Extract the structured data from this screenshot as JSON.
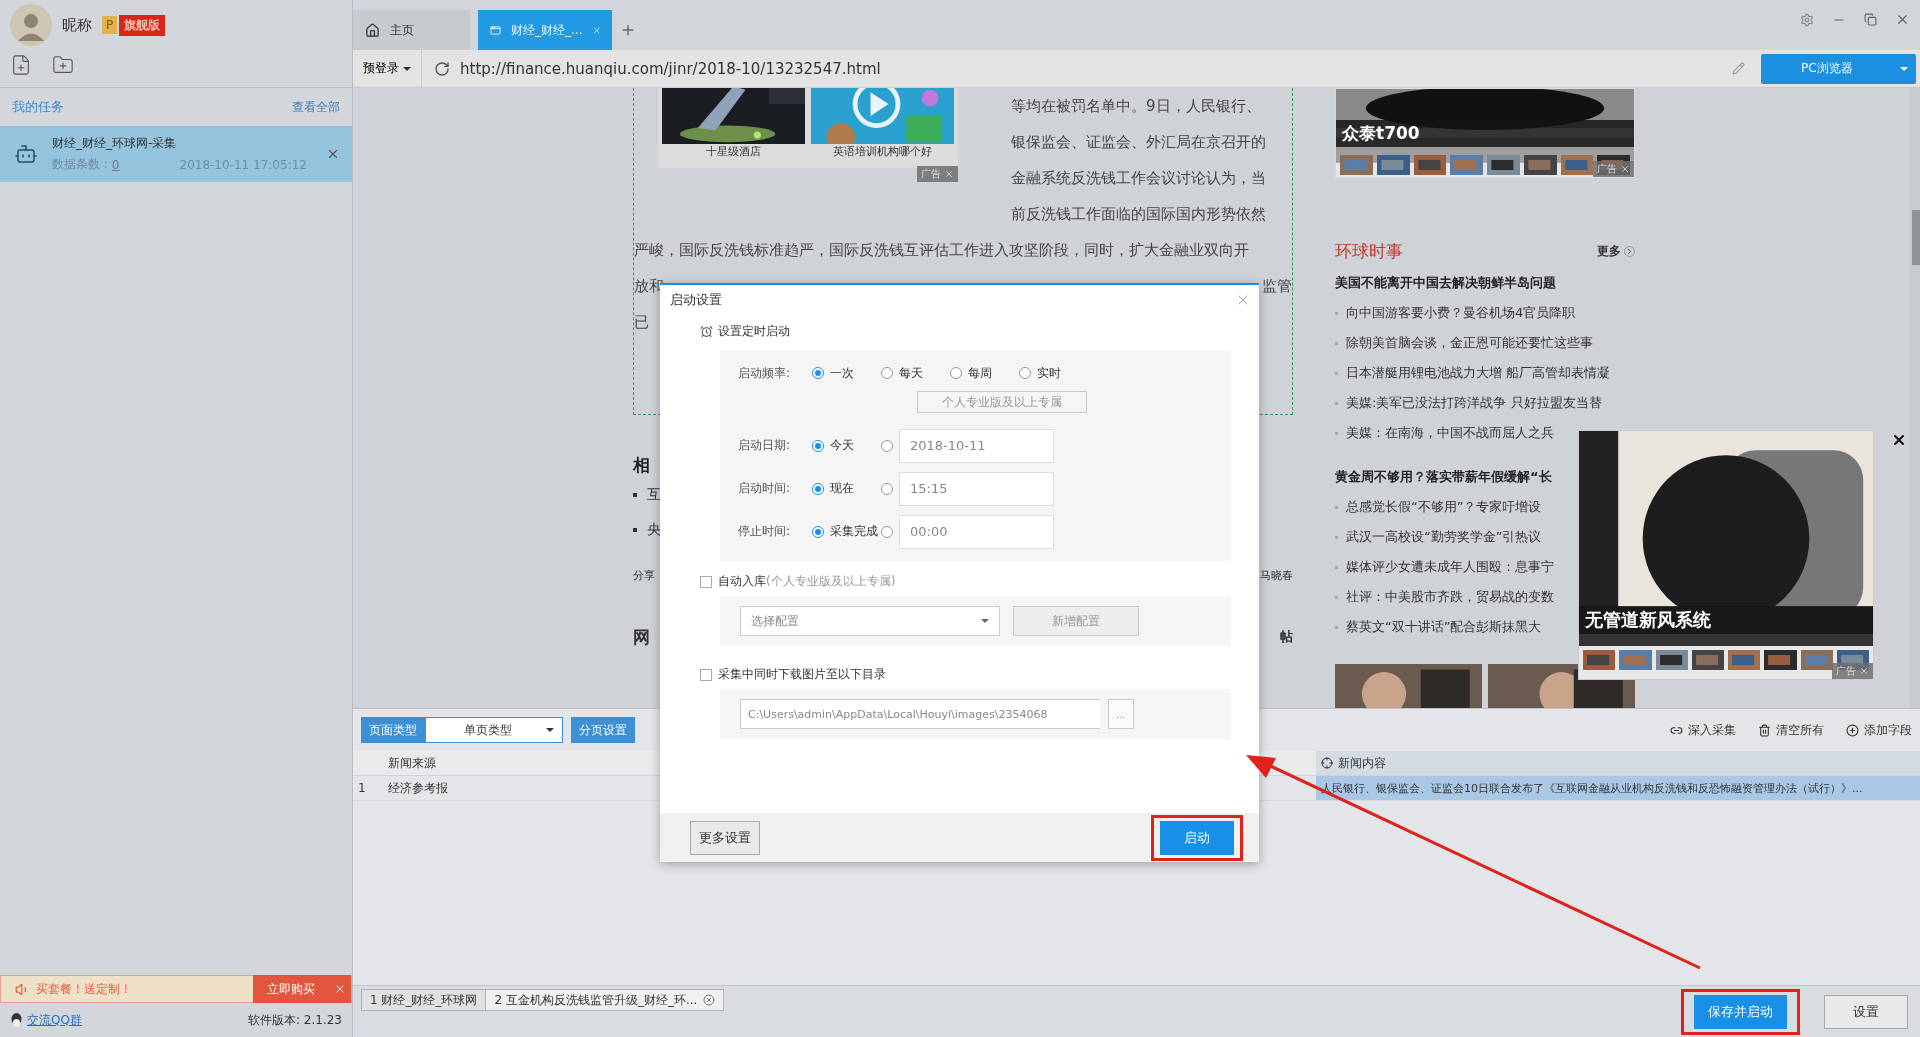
{
  "user": {
    "nickname": "昵称",
    "tier_letter": "P",
    "tier": "旗舰版"
  },
  "sidebar": {
    "section_title": "我的任务",
    "view_all": "查看全部",
    "tasks": [
      {
        "name": "财经_财经_环球网-采集",
        "count_label": "数据条数 :",
        "count": "0",
        "time": "2018-10-11 17:05:12",
        "selected": true
      }
    ],
    "promo": {
      "text": "买套餐！送定制！",
      "action": "立即购买"
    },
    "footer": {
      "qq_group": "交流QQ群",
      "version": "软件版本: 2.1.23"
    }
  },
  "browser": {
    "tabs": [
      {
        "kind": "home",
        "label": "主页",
        "selected": false
      },
      {
        "kind": "page",
        "label": "财经_财经_...",
        "selected": true
      }
    ],
    "prelogin": "预登录",
    "url": "http://finance.huanqiu.com/jinr/2018-10/13232547.html",
    "mode_button": "PC浏览器"
  },
  "page": {
    "ad_labels": [
      "广告",
      "广告",
      "广告"
    ],
    "ad_images": [
      {
        "caption": "十星级酒店"
      },
      {
        "caption": "英语培训机构哪个好"
      }
    ],
    "intro_lines": [
      "等均在被罚名单中。9日，人民银行、",
      "银保监会、证监会、外汇局在京召开的",
      "金融系统反洗钱工作会议讨论认为，当",
      "前反洗钱工作面临的国际国内形势依然"
    ],
    "lines": [
      {
        "left": "严峻，国际反洗钱标准趋严，国际反洗钱互评估工作进入攻坚阶段，同时，扩大金融业双向开"
      },
      {
        "left": "放和",
        "right": "监管"
      },
      {
        "left": "已"
      }
    ],
    "related_title": "相",
    "related_items": [
      "互",
      "央"
    ],
    "fragments": [
      {
        "kind": "meta",
        "left": "分享",
        "right": "马晓春"
      },
      {
        "kind": "heading",
        "left": "网",
        "right": "帖"
      }
    ],
    "news": {
      "ad_caption": "众泰t700",
      "title": "环球时事",
      "more": "更多",
      "groups": [
        {
          "headline": "美国不能离开中国去解决朝鲜半岛问题",
          "items": [
            "向中国游客要小费？曼谷机场4官员降职",
            "除朝美首脑会谈，金正恩可能还要忙这些事",
            "日本潜艇用锂电池战力大增 船厂高管却表情凝",
            "美媒:美军已没法打跨洋战争 只好拉盟友当替",
            "美媒：在南海，中国不战而屈人之兵"
          ]
        },
        {
          "headline": "黄金周不够用？落实带薪年假缓解“长",
          "items": [
            "总感觉长假“不够用”？专家吁增设",
            "武汉一高校设“勤劳奖学金”引热议",
            "媒体评少女遭未成年人围殴：息事宁",
            "社评：中美股市齐跌，贸易战的变数",
            "蔡英文“双十讲话”配合彭斯抹黑大"
          ]
        }
      ]
    },
    "float_ad": {
      "caption": "无管道新风系统"
    }
  },
  "panel": {
    "page_type_label": "页面类型",
    "page_type": "单页类型",
    "paging": "分页设置",
    "actions": [
      {
        "kind": "deep",
        "label": "深入采集"
      },
      {
        "kind": "clear",
        "label": "清空所有"
      },
      {
        "kind": "add",
        "label": "添加字段"
      }
    ],
    "columns": [
      {
        "label": "新闻来源",
        "selected": false
      },
      {
        "label": "新闻内容",
        "selected": true
      }
    ],
    "rows": [
      {
        "index": "1",
        "cells": [
          "经济参考报",
          "人民银行、银保监会、证监会10日联合发布了《互联网金融从业机构反洗钱和反恐怖融资管理办法（试行）》..."
        ]
      }
    ]
  },
  "task_tabs": [
    {
      "label": "1 财经_财经_环球网",
      "selected": false,
      "closable": false
    },
    {
      "label": "2 互金机构反洗钱监管升级_财经_环...",
      "selected": true,
      "closable": true
    }
  ],
  "save_start": "保存并启动",
  "settings": "设置",
  "dialog": {
    "title": "启动设置",
    "section": "设置定时启动",
    "frequency": {
      "label": "启动频率:",
      "pro_note": "个人专业版及以上专属",
      "options": [
        {
          "label": "一次",
          "selected": true
        },
        {
          "label": "每天",
          "selected": false
        },
        {
          "label": "每周",
          "selected": false
        },
        {
          "label": "实时",
          "selected": false
        }
      ]
    },
    "schedule": [
      {
        "label": "启动日期:",
        "default": {
          "label": "今天",
          "selected": true
        },
        "custom": {
          "selected": false,
          "value": "2018-10-11"
        }
      },
      {
        "label": "启动时间:",
        "default": {
          "label": "现在",
          "selected": true
        },
        "custom": {
          "selected": false,
          "value": "15:15"
        }
      },
      {
        "label": "停止时间:",
        "default": {
          "label": "采集完成",
          "selected": true
        },
        "custom": {
          "selected": false,
          "value": "00:00"
        }
      }
    ],
    "auto_store": {
      "label": "自动入库",
      "note": "(个人专业版及以上专属)",
      "checked": false,
      "select_placeholder": "选择配置",
      "add_button": "新增配置"
    },
    "download": {
      "label": "采集中同时下载图片至以下目录",
      "checked": false,
      "path": "C:\\Users\\admin\\AppData\\Local\\Houyi\\images\\2354068",
      "browse": "..."
    },
    "more_button": "更多设置",
    "start_button": "启动"
  }
}
